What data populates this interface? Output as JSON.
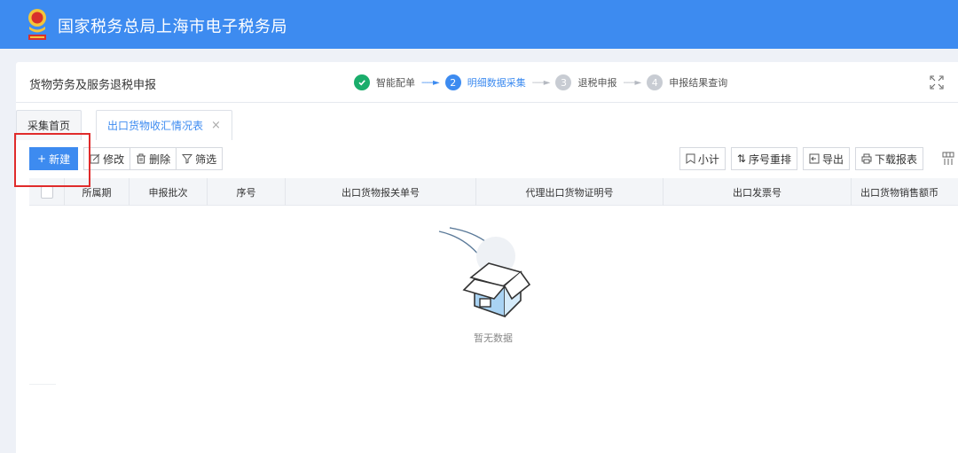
{
  "header": {
    "site_title": "国家税务总局上海市电子税务局",
    "emblem_icon": "tax-emblem-icon"
  },
  "panel": {
    "title": "货物劳务及服务退税申报",
    "steps": [
      {
        "num": "",
        "label": "智能配单",
        "state": "done"
      },
      {
        "num": "2",
        "label": "明细数据采集",
        "state": "active"
      },
      {
        "num": "3",
        "label": "退税申报",
        "state": "todo"
      },
      {
        "num": "4",
        "label": "申报结果查询",
        "state": "todo"
      }
    ],
    "fullscreen_icon": "expand-icon"
  },
  "tabs": [
    {
      "label": "采集首页",
      "active": false
    },
    {
      "label": "出口货物收汇情况表",
      "active": true,
      "close": "×"
    }
  ],
  "toolbar": {
    "new_label": "新建",
    "edit_label": "修改",
    "delete_label": "删除",
    "filter_label": "筛选",
    "subtotal_label": "小计",
    "reorder_label": "序号重排",
    "export_label": "导出",
    "download_label": "下载报表"
  },
  "table": {
    "columns": [
      "所属期",
      "申报批次",
      "序号",
      "出口货物报关单号",
      "代理出口货物证明号",
      "出口发票号",
      "出口货物销售额币"
    ]
  },
  "empty_text": "暂无数据",
  "colors": {
    "header_blue": "#3d8bf0",
    "step_done": "#1aad6b",
    "highlight_red": "#e02b2b"
  }
}
